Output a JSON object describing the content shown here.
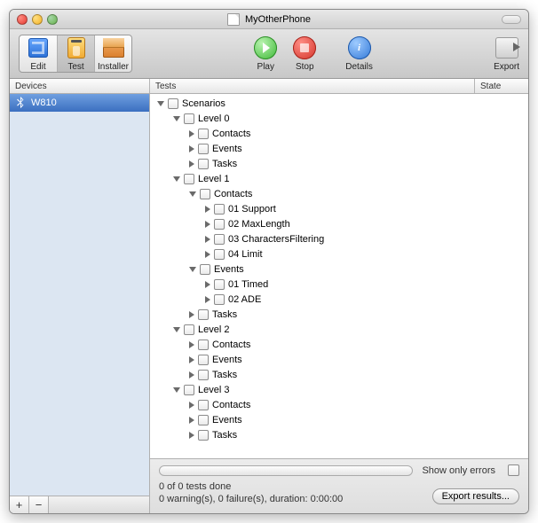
{
  "window": {
    "title": "MyOtherPhone"
  },
  "toolbar": {
    "edit": "Edit",
    "test": "Test",
    "installer": "Installer",
    "play": "Play",
    "stop": "Stop",
    "details": "Details",
    "export": "Export"
  },
  "columns": {
    "devices": "Devices",
    "tests": "Tests",
    "state": "State"
  },
  "devices": [
    {
      "name": "W810",
      "icon": "bluetooth"
    }
  ],
  "sidebar_buttons": {
    "add": "+",
    "remove": "−"
  },
  "tree": [
    {
      "depth": 0,
      "open": true,
      "label": "Scenarios"
    },
    {
      "depth": 1,
      "open": true,
      "label": "Level 0"
    },
    {
      "depth": 2,
      "open": false,
      "label": "Contacts"
    },
    {
      "depth": 2,
      "open": false,
      "label": "Events"
    },
    {
      "depth": 2,
      "open": false,
      "label": "Tasks"
    },
    {
      "depth": 1,
      "open": true,
      "label": "Level 1"
    },
    {
      "depth": 2,
      "open": true,
      "label": "Contacts"
    },
    {
      "depth": 3,
      "open": false,
      "label": "01 Support"
    },
    {
      "depth": 3,
      "open": false,
      "label": "02 MaxLength"
    },
    {
      "depth": 3,
      "open": false,
      "label": "03 CharactersFiltering"
    },
    {
      "depth": 3,
      "open": false,
      "label": "04 Limit"
    },
    {
      "depth": 2,
      "open": true,
      "label": "Events"
    },
    {
      "depth": 3,
      "open": false,
      "label": "01 Timed"
    },
    {
      "depth": 3,
      "open": false,
      "label": "02 ADE"
    },
    {
      "depth": 2,
      "open": false,
      "label": "Tasks"
    },
    {
      "depth": 1,
      "open": true,
      "label": "Level 2"
    },
    {
      "depth": 2,
      "open": false,
      "label": "Contacts"
    },
    {
      "depth": 2,
      "open": false,
      "label": "Events"
    },
    {
      "depth": 2,
      "open": false,
      "label": "Tasks"
    },
    {
      "depth": 1,
      "open": true,
      "label": "Level 3"
    },
    {
      "depth": 2,
      "open": false,
      "label": "Contacts"
    },
    {
      "depth": 2,
      "open": false,
      "label": "Events"
    },
    {
      "depth": 2,
      "open": false,
      "label": "Tasks"
    }
  ],
  "status": {
    "show_only_errors": "Show only errors",
    "tests_done": "0 of 0 tests done",
    "summary": "0 warning(s), 0 failure(s), duration: 0:00:00",
    "export_results": "Export results..."
  }
}
